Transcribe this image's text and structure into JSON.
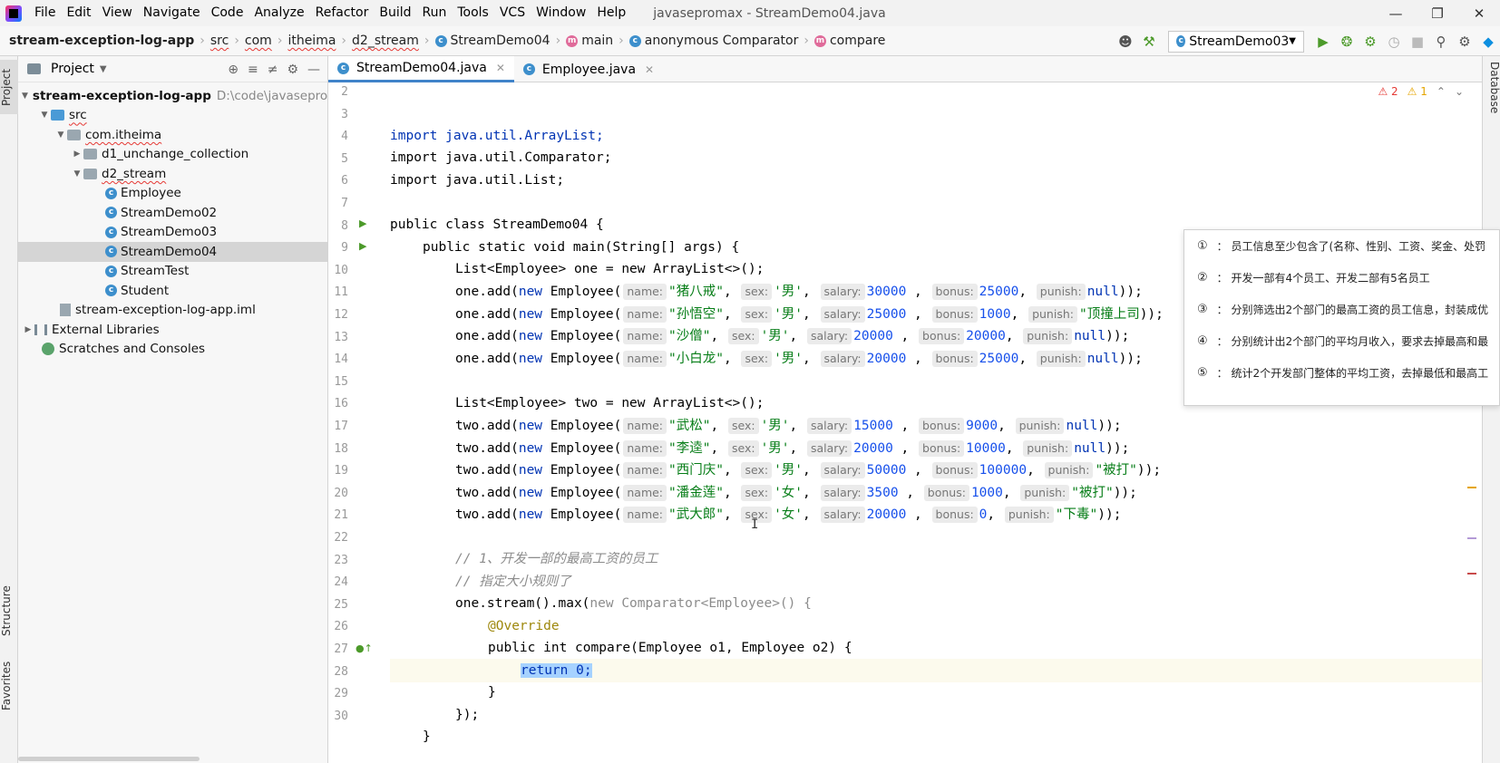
{
  "menubar": {
    "items": [
      "File",
      "Edit",
      "View",
      "Navigate",
      "Code",
      "Analyze",
      "Refactor",
      "Build",
      "Run",
      "Tools",
      "VCS",
      "Window",
      "Help"
    ],
    "window_title": "javasepromax - StreamDemo04.java"
  },
  "breadcrumbs": {
    "project": "stream-exception-log-app",
    "items": [
      "src",
      "com",
      "itheima",
      "d2_stream",
      "StreamDemo04",
      "main",
      "anonymous Comparator",
      "compare"
    ]
  },
  "toolbar": {
    "run_config": "StreamDemo03"
  },
  "left_strip": {
    "project": "Project",
    "structure": "Structure",
    "favorites": "Favorites"
  },
  "right_strip": {
    "database": "Database"
  },
  "project_panel": {
    "title": "Project",
    "root_label": "stream-exception-log-app",
    "root_path": "D:\\code\\javasepro",
    "src": "src",
    "package": "com.itheima",
    "folder1": "d1_unchange_collection",
    "folder2": "d2_stream",
    "classes": [
      "Employee",
      "StreamDemo02",
      "StreamDemo03",
      "StreamDemo04",
      "StreamTest",
      "Student"
    ],
    "iml": "stream-exception-log-app.iml",
    "external_libraries": "External Libraries",
    "scratches": "Scratches and Consoles"
  },
  "tabs": [
    {
      "label": "StreamDemo04.java"
    },
    {
      "label": "Employee.java"
    }
  ],
  "inspections": {
    "errors": "2",
    "warnings": "1"
  },
  "line_numbers": [
    "2",
    "3",
    "4",
    "5",
    "6",
    "7",
    "8",
    "9",
    "10",
    "11",
    "12",
    "13",
    "14",
    "15",
    "16",
    "17",
    "18",
    "19",
    "20",
    "21",
    "22",
    "23",
    "24",
    "25",
    "26",
    "27",
    "28",
    "29",
    "30"
  ],
  "code": {
    "import1": "import java.util.ArrayList;",
    "import2": "import java.util.Comparator;",
    "import3": "import java.util.List;",
    "class_decl": "public class StreamDemo04 {",
    "main_decl": "public static void main(String[] args) {",
    "list_one": "List<Employee> one = new ArrayList<>();",
    "list_two": "List<Employee> two = new ArrayList<>();",
    "hint_name": "name:",
    "hint_sex": "sex:",
    "hint_salary": "salary:",
    "hint_bonus": "bonus:",
    "hint_punish": "punish:",
    "one_rows": [
      {
        "name": "\"猪八戒\"",
        "sex": "'男'",
        "salary": "30000",
        "bonus": "25000",
        "punish": "null"
      },
      {
        "name": "\"孙悟空\"",
        "sex": "'男'",
        "salary": "25000",
        "bonus": "1000",
        "punish": "\"顶撞上司"
      },
      {
        "name": "\"沙僧\"",
        "sex": "'男'",
        "salary": "20000",
        "bonus": "20000",
        "punish": "null"
      },
      {
        "name": "\"小白龙\"",
        "sex": "'男'",
        "salary": "20000",
        "bonus": "25000",
        "punish": "null"
      }
    ],
    "two_rows": [
      {
        "name": "\"武松\"",
        "sex": "'男'",
        "salary": "15000",
        "bonus": "9000",
        "punish": "null"
      },
      {
        "name": "\"李逵\"",
        "sex": "'男'",
        "salary": "20000",
        "bonus": "10000",
        "punish": "null"
      },
      {
        "name": "\"西门庆\"",
        "sex": "'男'",
        "salary": "50000",
        "bonus": "100000",
        "punish": "\"被打\""
      },
      {
        "name": "\"潘金莲\"",
        "sex": "'女'",
        "salary": "3500",
        "bonus": "1000",
        "punish": "\"被打\""
      },
      {
        "name": "\"武大郎\"",
        "sex": "'女'",
        "salary": "20000",
        "bonus": "0",
        "punish": "\"下毒\""
      }
    ],
    "comment1": "// 1、开发一部的最高工资的员工",
    "comment2": "// 指定大小规则了",
    "stream_line": "one.stream().max(",
    "stream_new": "new Comparator<Employee>() {",
    "override": "@Override",
    "compare_decl": "public int compare(Employee o1, Employee o2) {",
    "return_stmt": "return 0;",
    "close1": "}",
    "close2": "});",
    "close3": "}"
  },
  "popup": {
    "items": [
      {
        "num": "①",
        "text": "：  员工信息至少包含了(名称、性别、工资、奖金、处罚"
      },
      {
        "num": "②",
        "text": "：  开发一部有4个员工、开发二部有5名员工"
      },
      {
        "num": "③",
        "text": "：  分别筛选出2个部门的最高工资的员工信息，封装成优"
      },
      {
        "num": "④",
        "text": "：  分别统计出2个部门的平均月收入，要求去掉最高和最"
      },
      {
        "num": "⑤",
        "text": "：  统计2个开发部门整体的平均工资，去掉最低和最高工"
      }
    ]
  },
  "colors": {
    "keyword": "#0033b3",
    "string": "#067d17",
    "number": "#1750eb",
    "selection": "#a6d2ff",
    "tab_accent": "#4083c9"
  }
}
